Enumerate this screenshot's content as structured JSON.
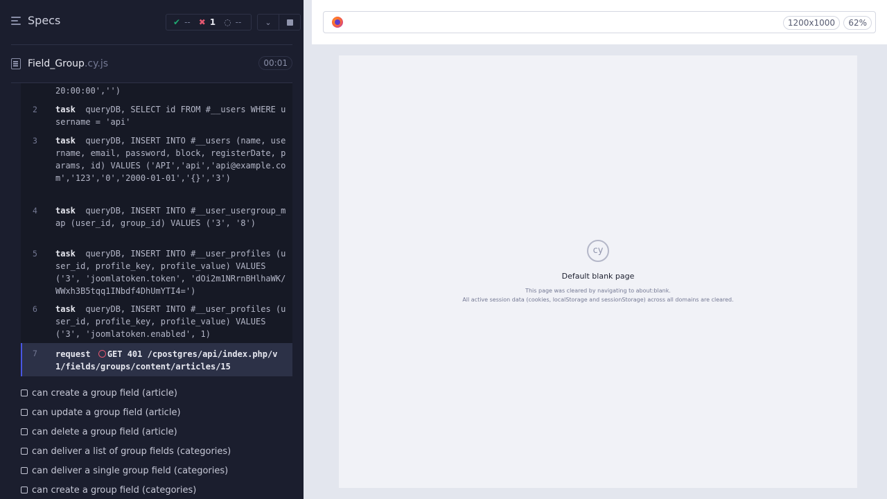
{
  "reporter": {
    "specs_label": "Specs",
    "stats": {
      "passed": "--",
      "failed": "1",
      "pending": "--"
    },
    "spec_file": {
      "name": "Field_Group",
      "ext": ".cy.js",
      "duration": "00:01"
    },
    "commands": [
      {
        "num": "",
        "keyword": "",
        "text": "20:00:00','')"
      },
      {
        "num": "2",
        "keyword": "task",
        "text": "queryDB, SELECT id FROM #__users WHERE username = 'api'"
      },
      {
        "num": "3",
        "keyword": "task",
        "text": "queryDB, INSERT INTO #__users (name, username, email, password, block, registerDate, params, id) VALUES ('API','api','api@example.com','123','0','2000-01-01','{}','3')"
      },
      {
        "num": "4",
        "keyword": "task",
        "text": "queryDB, INSERT INTO #__user_usergroup_map (user_id, group_id) VALUES ('3', '8')"
      },
      {
        "num": "5",
        "keyword": "task",
        "text": "queryDB, INSERT INTO #__user_profiles (user_id, profile_key, profile_value) VALUES ('3', 'joomlatoken.token', 'dOi2m1NRrnBHlhaWK/WWxh3B5tqq1INbdf4DhUmYTI4=')"
      },
      {
        "num": "6",
        "keyword": "task",
        "text": "queryDB, INSERT INTO #__user_profiles (user_id, profile_key, profile_value) VALUES ('3', 'joomlatoken.enabled', 1)"
      },
      {
        "num": "7",
        "keyword": "request",
        "text": "GET 401 /cpostgres/api/index.php/v1/fields/groups/content/articles/15"
      }
    ],
    "tests": [
      "can create a group field (article)",
      "can update a group field (article)",
      "can delete a group field (article)",
      "can deliver a list of group fields (categories)",
      "can deliver a single group field (categories)",
      "can create a group field (categories)"
    ]
  },
  "aut": {
    "viewport_size": "1200x1000",
    "zoom": "62%",
    "blank_title": "Default blank page",
    "blank_line1": "This page was cleared by navigating to about:blank.",
    "blank_line2": "All active session data (cookies, localStorage and sessionStorage) across all domains are cleared.",
    "logo_text": "cy"
  },
  "colors": {
    "pass": "#1fa971",
    "fail": "#e45770",
    "accent": "#4956e3"
  }
}
